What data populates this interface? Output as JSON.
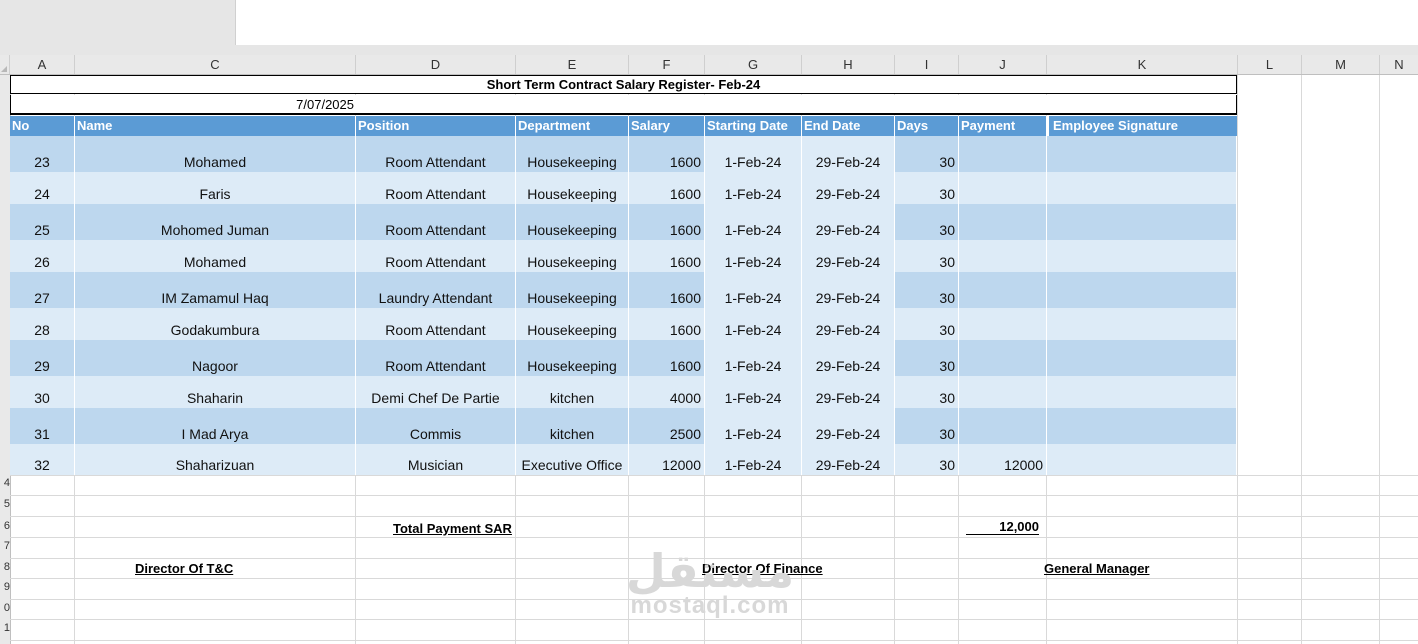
{
  "columns": [
    "A",
    "C",
    "D",
    "E",
    "F",
    "G",
    "H",
    "I",
    "J",
    "K",
    "L",
    "M",
    "N"
  ],
  "row_numbers": [
    "",
    "",
    "",
    "",
    "",
    "",
    "",
    "",
    "",
    "",
    "",
    "",
    "",
    "",
    "",
    "",
    "",
    "",
    "",
    "",
    "",
    "",
    "",
    "",
    "",
    "4",
    "5",
    "6",
    "7",
    "8",
    "9",
    "0",
    "1"
  ],
  "sheet": {
    "title": "Short Term Contract Salary Register- Feb-24",
    "date": "7/07/2025",
    "headers": [
      "No",
      "Name",
      "Position",
      "Department",
      "Salary",
      "Starting Date",
      "End Date",
      "Days",
      "Payment",
      "Employee Signature"
    ],
    "rows": [
      {
        "no": "23",
        "name": "Mohamed",
        "position": "Room Attendant",
        "department": "Housekeeping",
        "salary": "1600",
        "start": "1-Feb-24",
        "end": "29-Feb-24",
        "days": "30",
        "payment": ""
      },
      {
        "no": "24",
        "name": "Faris",
        "position": "Room Attendant",
        "department": "Housekeeping",
        "salary": "1600",
        "start": "1-Feb-24",
        "end": "29-Feb-24",
        "days": "30",
        "payment": ""
      },
      {
        "no": "25",
        "name": "Mohomed Juman",
        "position": "Room Attendant",
        "department": "Housekeeping",
        "salary": "1600",
        "start": "1-Feb-24",
        "end": "29-Feb-24",
        "days": "30",
        "payment": ""
      },
      {
        "no": "26",
        "name": "Mohamed",
        "position": "Room Attendant",
        "department": "Housekeeping",
        "salary": "1600",
        "start": "1-Feb-24",
        "end": "29-Feb-24",
        "days": "30",
        "payment": ""
      },
      {
        "no": "27",
        "name": "IM Zamamul Haq",
        "position": "Laundry Attendant",
        "department": "Housekeeping",
        "salary": "1600",
        "start": "1-Feb-24",
        "end": "29-Feb-24",
        "days": "30",
        "payment": ""
      },
      {
        "no": "28",
        "name": "Godakumbura",
        "position": "Room Attendant",
        "department": "Housekeeping",
        "salary": "1600",
        "start": "1-Feb-24",
        "end": "29-Feb-24",
        "days": "30",
        "payment": ""
      },
      {
        "no": "29",
        "name": "Nagoor",
        "position": "Room Attendant",
        "department": "Housekeeping",
        "salary": "1600",
        "start": "1-Feb-24",
        "end": "29-Feb-24",
        "days": "30",
        "payment": ""
      },
      {
        "no": "30",
        "name": "Shaharin",
        "position": "Demi Chef De Partie",
        "department": "kitchen",
        "salary": "4000",
        "start": "1-Feb-24",
        "end": "29-Feb-24",
        "days": "30",
        "payment": ""
      },
      {
        "no": "31",
        "name": "I Mad Arya",
        "position": "Commis",
        "department": "kitchen",
        "salary": "2500",
        "start": "1-Feb-24",
        "end": "29-Feb-24",
        "days": "30",
        "payment": ""
      },
      {
        "no": "32",
        "name": "Shaharizuan",
        "position": "Musician",
        "department": "Executive Office",
        "salary": "12000",
        "start": "1-Feb-24",
        "end": "29-Feb-24",
        "days": "30",
        "payment": "12000"
      }
    ],
    "total_label": "Total Payment  SAR",
    "total_value": "12,000",
    "signatures": [
      "Director Of T&C",
      "Director Of Finance",
      "General Manager"
    ]
  },
  "watermark": {
    "arabic": "مستقل",
    "latin": "mostaql.com"
  },
  "colors": {
    "header_blue": "#5b9bd5",
    "band_dark": "#bdd7ee",
    "band_light": "#ddebf7"
  }
}
